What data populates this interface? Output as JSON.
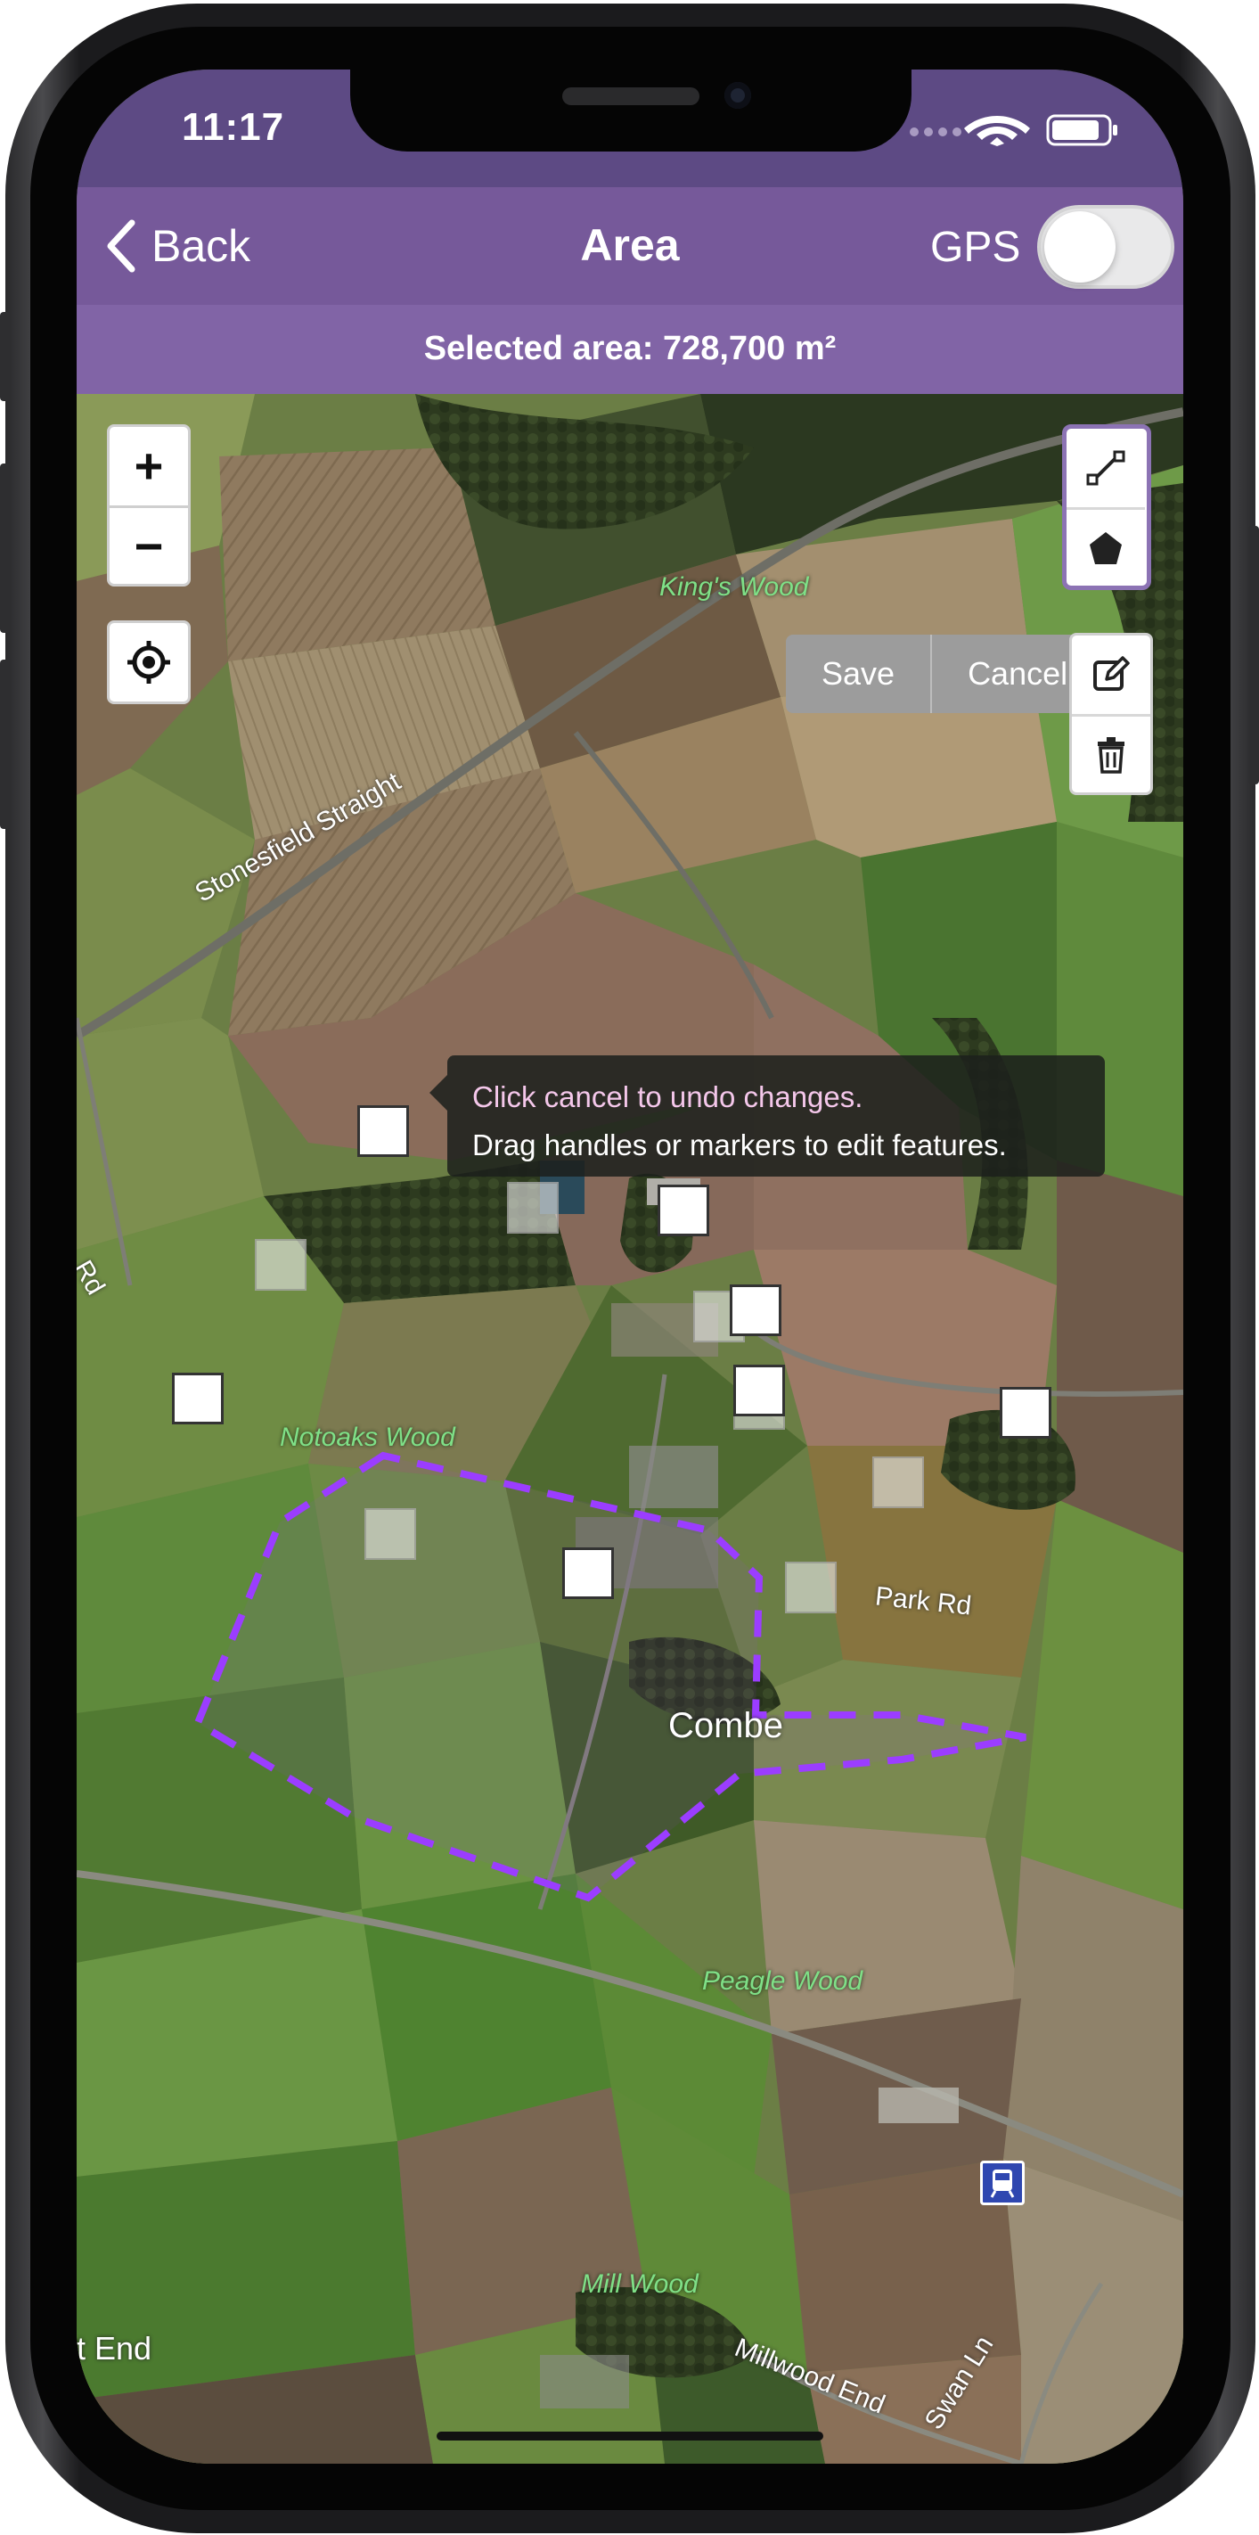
{
  "status_bar": {
    "time": "11:17",
    "icons": [
      "signal-dots-icon",
      "wifi-icon",
      "battery-icon"
    ]
  },
  "nav": {
    "back_label": "Back",
    "title": "Area",
    "gps_label": "GPS",
    "gps_enabled": false
  },
  "area_bar": {
    "text": "Selected area: 728,700 m²"
  },
  "map_controls": {
    "zoom_in": "+",
    "zoom_out": "−",
    "actions": {
      "save": "Save",
      "cancel": "Cancel"
    }
  },
  "tooltip": {
    "line1": "Click cancel to undo changes.",
    "line2": "Drag handles or markers to edit features."
  },
  "map_labels": {
    "kings_wood": "King's Wood",
    "stonesfield": "Stonesfield Straight",
    "notoaks": "Notoaks Wood",
    "rd": "Rd",
    "park_rd": "Park Rd",
    "combe": "Combe",
    "peagle": "Peagle Wood",
    "mill_wood": "Mill Wood",
    "t_end": "t End",
    "millwood_end": "Millwood End",
    "swan_ln": "Swan Ln"
  },
  "colors": {
    "header_primary": "#76599a",
    "status_bar": "#5d4a84",
    "area_bar": "#8164a6",
    "polygon_stroke": "#9b3dff",
    "tooltip_highlight": "#f4c7ea"
  }
}
